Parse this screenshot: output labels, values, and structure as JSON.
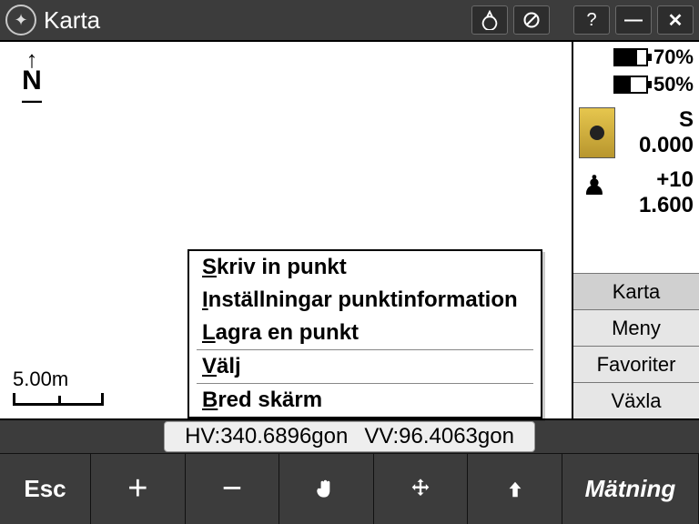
{
  "titlebar": {
    "title": "Karta"
  },
  "map": {
    "north_label": "N",
    "scale_label": "5.00m"
  },
  "context_menu": {
    "items": [
      {
        "u": "S",
        "rest": "kriv in punkt"
      },
      {
        "u": "I",
        "rest": "nställningar punktinformation"
      },
      {
        "u": "L",
        "rest": "agra en punkt"
      },
      {
        "sep": true
      },
      {
        "u": "V",
        "rest": "älj"
      },
      {
        "sep": true
      },
      {
        "u": "B",
        "rest": "red skärm"
      }
    ]
  },
  "right_panel": {
    "battery1": {
      "pct_label": "70%",
      "fill": 70
    },
    "battery2": {
      "pct_label": "50%",
      "fill": 50
    },
    "instrument": {
      "face": "S",
      "distance": "0.000"
    },
    "prism": {
      "offset": "+10",
      "height": "1.600"
    },
    "buttons": {
      "karta": "Karta",
      "meny": "Meny",
      "favoriter": "Favoriter",
      "vaxla": "Växla"
    }
  },
  "status": {
    "hv_label": "HV:",
    "hv_val": "340.6896gon",
    "vv_label": "VV:",
    "vv_val": "96.4063gon"
  },
  "softkeys": {
    "esc": "Esc",
    "matning": "Mätning"
  }
}
